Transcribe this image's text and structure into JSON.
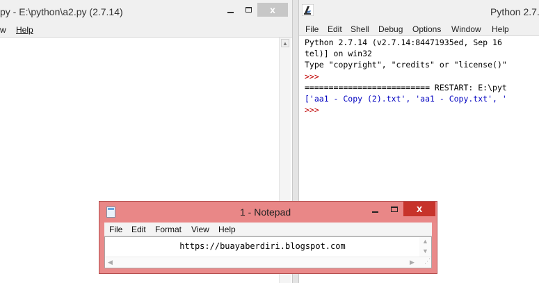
{
  "left_window": {
    "title": "py - E:\\python\\a2.py (2.7.14)",
    "menu": [
      "w",
      "Help"
    ],
    "controls": {
      "minimize_icon": "minimize-icon",
      "maximize_icon": "maximize-icon",
      "close_label": "x"
    }
  },
  "right_window": {
    "title": "Python 2.7.",
    "menu": [
      "File",
      "Edit",
      "Shell",
      "Debug",
      "Options",
      "Window",
      "Help"
    ],
    "shell_lines": [
      {
        "text": "Python 2.7.14 (v2.7.14:84471935ed, Sep 16",
        "kind": "default"
      },
      {
        "text": "tel)] on win32",
        "kind": "default"
      },
      {
        "text": "Type \"copyright\", \"credits\" or \"license()\"",
        "kind": "default"
      },
      {
        "text": ">>>",
        "kind": "prompt"
      },
      {
        "text": "========================== RESTART: E:\\pyt",
        "kind": "default"
      },
      {
        "text": "['aa1 - Copy (2).txt', 'aa1 - Copy.txt', '",
        "kind": "output"
      },
      {
        "text": ">>>",
        "kind": "prompt"
      }
    ]
  },
  "notepad": {
    "title": "1 - Notepad",
    "menu": [
      "File",
      "Edit",
      "Format",
      "View",
      "Help"
    ],
    "content": "https://buayaberdiri.blogspot.com",
    "close_label": "x"
  },
  "colors": {
    "notepad_frame": "#e98a8a",
    "close_button": "#c7332b",
    "shell_prompt": "#c00000",
    "shell_output": "#0000c0"
  }
}
